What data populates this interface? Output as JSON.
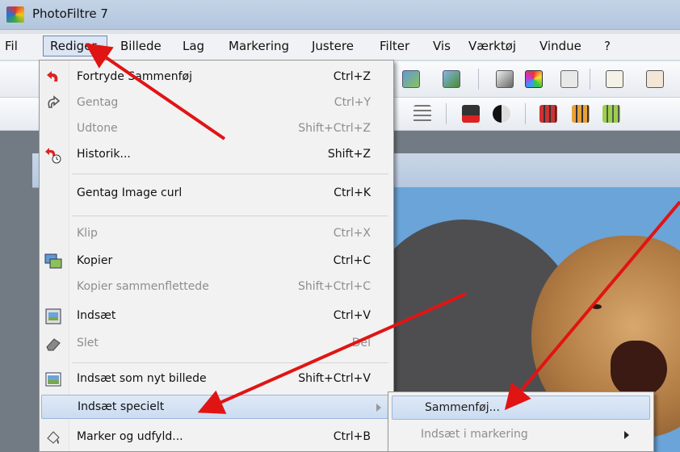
{
  "window": {
    "title": "PhotoFiltre 7"
  },
  "menubar": {
    "items": [
      "Fil",
      "Rediger",
      "Billede",
      "Lag",
      "Markering",
      "Justere",
      "Filter",
      "Vis",
      "Værktøj",
      "Vindue",
      "?"
    ]
  },
  "edit_menu": {
    "items": [
      {
        "label": "Fortryde Sammenføj",
        "shortcut": "Ctrl+Z",
        "enabled": true,
        "icon": "undo-icon"
      },
      {
        "label": "Gentag",
        "shortcut": "Ctrl+Y",
        "enabled": false,
        "icon": "redo-icon"
      },
      {
        "label": "Udtone",
        "shortcut": "Shift+Ctrl+Z",
        "enabled": false,
        "icon": ""
      },
      {
        "label": "Historik...",
        "shortcut": "Shift+Z",
        "enabled": true,
        "icon": "history-icon"
      },
      {
        "label": "Gentag Image curl",
        "shortcut": "Ctrl+K",
        "enabled": true,
        "icon": ""
      },
      {
        "label": "Klip",
        "shortcut": "Ctrl+X",
        "enabled": false,
        "icon": ""
      },
      {
        "label": "Kopier",
        "shortcut": "Ctrl+C",
        "enabled": true,
        "icon": "copy-icon"
      },
      {
        "label": "Kopier sammenflettede",
        "shortcut": "Shift+Ctrl+C",
        "enabled": false,
        "icon": ""
      },
      {
        "label": "Indsæt",
        "shortcut": "Ctrl+V",
        "enabled": true,
        "icon": "paste-icon"
      },
      {
        "label": "Slet",
        "shortcut": "Del",
        "enabled": false,
        "icon": "eraser-icon"
      },
      {
        "label": "Indsæt som nyt billede",
        "shortcut": "Shift+Ctrl+V",
        "enabled": true,
        "icon": "paste-new-icon"
      },
      {
        "label": "Indsæt specielt",
        "shortcut": "",
        "enabled": true,
        "icon": "",
        "highlighted": true,
        "submenu": true
      },
      {
        "label": "Marker og udfyld...",
        "shortcut": "Ctrl+B",
        "enabled": true,
        "icon": "fill-icon"
      }
    ]
  },
  "submenu": {
    "items": [
      {
        "label": "Sammenføj...",
        "enabled": true,
        "highlighted": true
      },
      {
        "label": "Indsæt i markering",
        "enabled": false,
        "submenu": true
      }
    ]
  },
  "colors": {
    "annotation_arrow": "#e11414",
    "menu_highlight": "#cbdcf1",
    "titlebar": "#b9cbe2"
  }
}
